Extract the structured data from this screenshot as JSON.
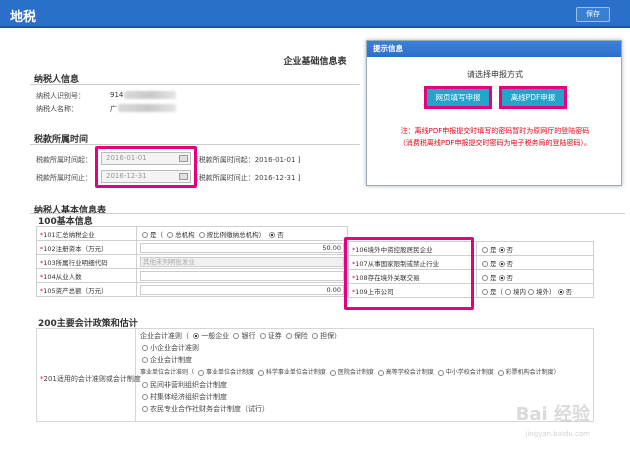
{
  "header": {
    "logo": "地税",
    "save_label": "保存"
  },
  "page_title": "企业基础信息表",
  "taxpayer": {
    "title": "纳税人信息",
    "id_label": "纳税人识别号：",
    "id_value": "914",
    "name_label": "纳税人名称：",
    "name_value": "广"
  },
  "period": {
    "title": "税款所属时间",
    "start_label": "税款所属时间起：",
    "start_value": "2016-01-01",
    "start_hint": "[税款所属时间起：2016-01-01 ]",
    "end_label": "税款所属时间止：",
    "end_value": "2016-12-31",
    "end_hint": "[税款所属时间止：2016-12-31 ]"
  },
  "basic": {
    "title": "纳税人基本信息表",
    "subtitle": "100基本信息",
    "rows": [
      {
        "label": "101汇总纳税企业",
        "opts": [
          "是（",
          "总机构",
          "按比例缴纳总机构）",
          "否"
        ]
      },
      {
        "label": "102注册资本（万元）",
        "value": "50.00"
      },
      {
        "label": "103所属行业明细代码",
        "value": "其他未列明批发业"
      },
      {
        "label": "104从业人数",
        "value": ""
      },
      {
        "label": "105资产总额（万元）",
        "value": "0.00"
      }
    ],
    "right_rows": [
      {
        "label": "106境外中资控股居民企业",
        "yes": "是",
        "no": "否"
      },
      {
        "label": "107从事国家限制或禁止行业",
        "yes": "是",
        "no": "否"
      },
      {
        "label": "108存在境外关联交易",
        "yes": "是",
        "no": "否"
      },
      {
        "label": "109上市公司",
        "yes": "是（",
        "in": "境内",
        "out": "境外）",
        "no": "否"
      }
    ]
  },
  "policy": {
    "title": "200主要会计政策和估计",
    "row_label": "201适用的会计准则或会计制度",
    "line1": [
      "企业会计准则（",
      "一般企业",
      "银行",
      "证券",
      "保险",
      "担保）"
    ],
    "line2": "小企业会计准则",
    "line3": "企业会计制度",
    "line4": [
      "事业单位会计准则（",
      "事业单位会计制度",
      "科学事业单位会计制度",
      "医院会计制度",
      "高等学校会计制度",
      "中小学校会计制度",
      "彩票机构会计制度）"
    ],
    "line5": "民间非营利组织会计制度",
    "line6": "村集体经济组织会计制度",
    "line7": "农民专业合作社财务会计制度（试行）"
  },
  "popup": {
    "title": "提示信息",
    "prompt": "请选择申报方式",
    "web_button": "网页填写申报",
    "pdf_button": "离线PDF申报",
    "note_line1": "注：离线PDF申报提交时填写的密码暂时为原网厅的登陆密码",
    "note_line2": "（消费税离线PDF申报提交时密码为电子税务局的登陆密码）。"
  },
  "watermark": {
    "main": "Bai 经验",
    "sub": "jingyan.baidu.com"
  },
  "colors": {
    "header_blue": "#2a6fc9",
    "highlight_pink": "#e4007f",
    "button_teal": "#24a4c8",
    "note_red": "#e60012"
  }
}
